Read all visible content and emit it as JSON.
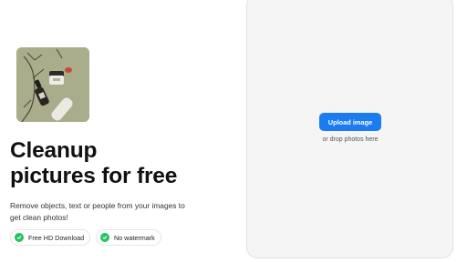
{
  "hero": {
    "headline_line1": "Cleanup",
    "headline_line2": "pictures for free",
    "subtitle": "Remove objects, text or people from your images to get clean photos!",
    "badges": [
      {
        "label": "Free HD Download",
        "icon": "check-circle-icon"
      },
      {
        "label": "No watermark",
        "icon": "check-circle-icon"
      }
    ]
  },
  "upload": {
    "button_label": "Upload image",
    "hint": "or drop photos here"
  },
  "colors": {
    "primary": "#1a7cf0",
    "check": "#22c55e",
    "panel_bg": "#f5f5f5",
    "image_bg": "#a9ad8c"
  }
}
